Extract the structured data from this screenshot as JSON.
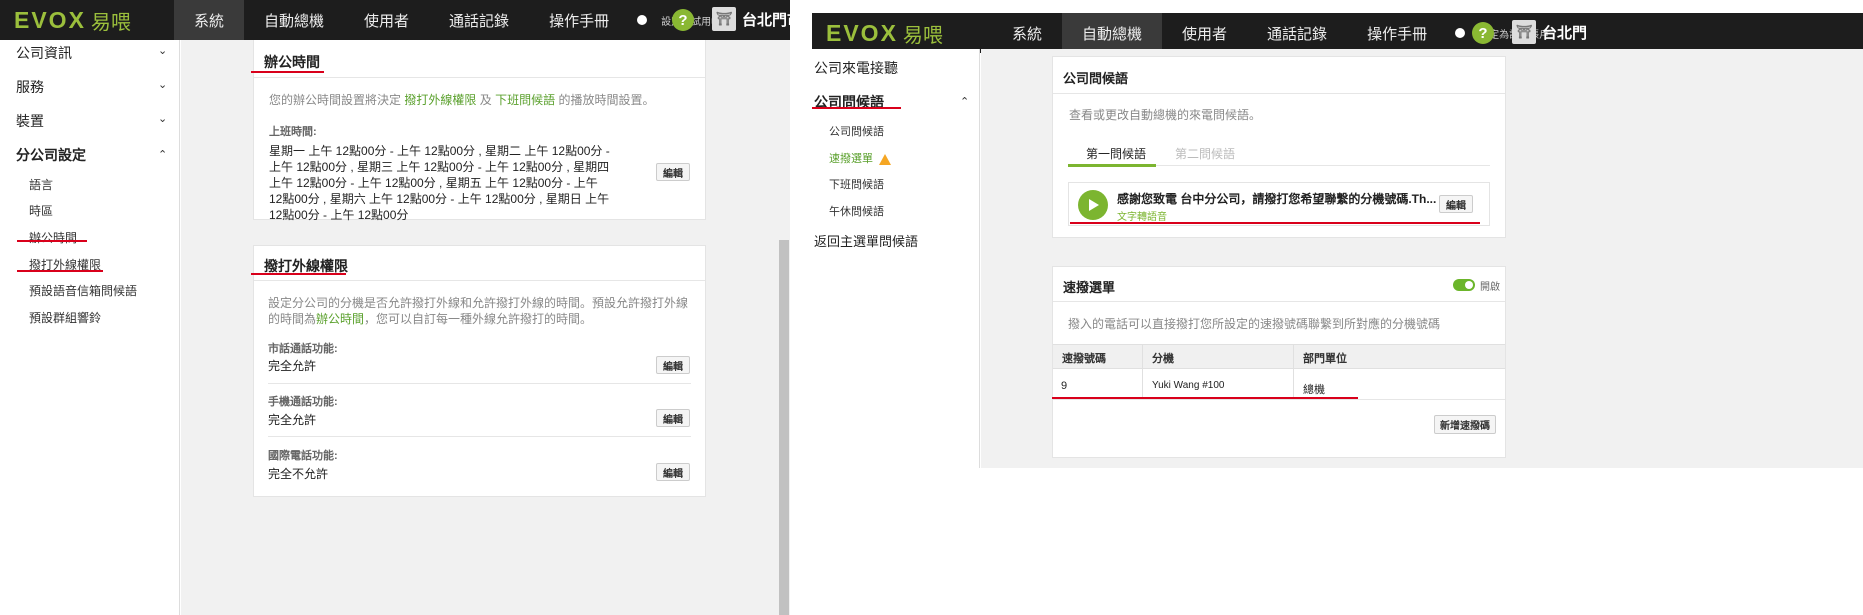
{
  "left": {
    "logo_en": "EVOX",
    "logo_zh": "易喂",
    "nav": [
      "系統",
      "自動總機",
      "使用者",
      "通話記錄",
      "操作手冊"
    ],
    "trial_label": "設定為試用帳戶",
    "help": "?",
    "account": "台北門市",
    "sidebar": {
      "top_items": [
        "公司資訊",
        "服務",
        "裝置",
        "分公司設定"
      ],
      "sub_items": [
        "語言",
        "時區",
        "辦公時間",
        "撥打外線權限",
        "預設語音信箱問候語",
        "預設群組響鈴"
      ]
    },
    "office_hours": {
      "title": "辦公時間",
      "desc_pre": "您的辦公時間設置將決定",
      "desc_link1": "撥打外線權限",
      "desc_mid": "及",
      "desc_link2": "下班問候語",
      "desc_post": "的播放時間設置。",
      "label": "上班時間:",
      "value": "星期一 上午 12點00分 - 上午 12點00分 , 星期二 上午 12點00分 - 上午 12點00分 , 星期三 上午 12點00分 - 上午 12點00分 , 星期四 上午 12點00分 - 上午 12點00分 , 星期五 上午 12點00分 - 上午 12點00分 , 星期六 上午 12點00分 - 上午 12點00分 , 星期日 上午 12點00分 - 上午 12點00分",
      "edit": "編輯"
    },
    "outbound": {
      "title": "撥打外線權限",
      "desc_pre": "設定分公司的分機是否允許撥打外線和允許撥打外線的時間。預設允許撥打外線的時間為",
      "desc_link": "辦公時間",
      "desc_post": "，您可以自訂每一種外線允許撥打的時間。",
      "rows": [
        {
          "label": "市話通話功能:",
          "value": "完全允許",
          "edit": "編輯"
        },
        {
          "label": "手機通話功能:",
          "value": "完全允許",
          "edit": "編輯"
        },
        {
          "label": "國際電話功能:",
          "value": "完全不允許",
          "edit": "編輯"
        }
      ]
    }
  },
  "right": {
    "logo_en": "EVOX",
    "logo_zh": "易喂",
    "nav": [
      "系統",
      "自動總機",
      "使用者",
      "通話記錄",
      "操作手冊"
    ],
    "trial_label": "設定為試用帳戶",
    "help": "?",
    "account": "台北門",
    "sidebar": {
      "items": [
        "公司來電接聽",
        "公司問候語"
      ],
      "sub_items": [
        "公司問候語",
        "速撥選單",
        "下班問候語",
        "午休問候語"
      ],
      "back": "返回主選單問候語"
    },
    "greeting": {
      "title": "公司問候語",
      "desc": "查看或更改自動總機的來電問候語。",
      "tabs": [
        "第一問候語",
        "第二問候語"
      ],
      "message": "感謝您致電 台中分公司，請撥打您希望聯繫的分機號碼.Th...",
      "message_type": "文字轉語音",
      "edit": "編輯"
    },
    "speed_dial": {
      "title": "速撥選單",
      "toggle_label": "開啟",
      "desc": "撥入的電話可以直接撥打您所設定的速撥號碼聯繫到所對應的分機號碼",
      "columns": [
        "速撥號碼",
        "分機",
        "部門單位"
      ],
      "rows": [
        {
          "code": "9",
          "ext": "Yuki Wang #100",
          "dept": "總機"
        }
      ],
      "add_button": "新增速撥碼"
    }
  }
}
